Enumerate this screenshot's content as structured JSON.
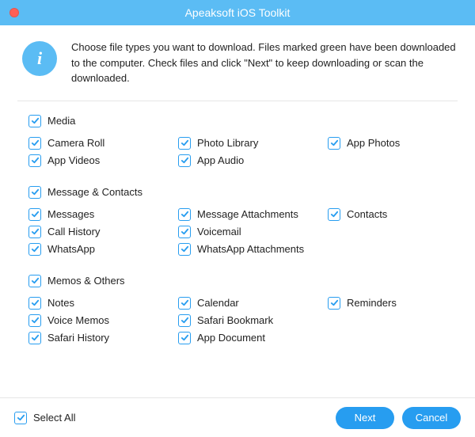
{
  "window": {
    "title": "Apeaksoft iOS Toolkit"
  },
  "info": {
    "badge": "i",
    "text": "Choose file types you want to download. Files marked green have been downloaded to the computer. Check files and click \"Next\" to keep downloading or scan the downloaded."
  },
  "groups": [
    {
      "title": "Media",
      "rows": [
        [
          "Camera Roll",
          "Photo Library",
          "App Photos"
        ],
        [
          "App Videos",
          "App Audio",
          ""
        ]
      ]
    },
    {
      "title": "Message & Contacts",
      "rows": [
        [
          "Messages",
          "Message Attachments",
          "Contacts"
        ],
        [
          "Call History",
          "Voicemail",
          ""
        ],
        [
          "WhatsApp",
          "WhatsApp Attachments",
          ""
        ]
      ]
    },
    {
      "title": "Memos & Others",
      "rows": [
        [
          "Notes",
          "Calendar",
          "Reminders"
        ],
        [
          "Voice Memos",
          "Safari Bookmark",
          ""
        ],
        [
          "Safari History",
          "App Document",
          ""
        ]
      ]
    }
  ],
  "footer": {
    "select_all": "Select All",
    "next": "Next",
    "cancel": "Cancel"
  },
  "colors": {
    "accent": "#279df0",
    "titlebar": "#5bbcf4"
  }
}
